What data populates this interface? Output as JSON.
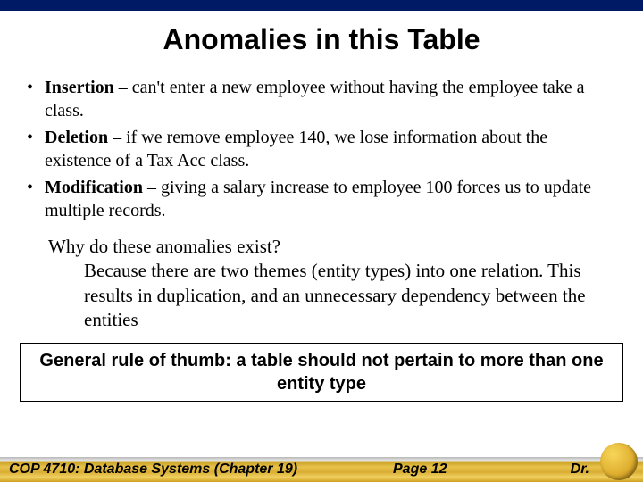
{
  "title": "Anomalies in this Table",
  "bullets": [
    {
      "term": "Insertion",
      "text": " – can't enter a new employee without having the employee take a class."
    },
    {
      "term": "Deletion",
      "text": " – if we remove employee 140, we lose information about the existence of a Tax Acc class."
    },
    {
      "term": "Modification",
      "text": " – giving a salary increase to employee 100 forces us to update multiple records."
    }
  ],
  "why": {
    "q": "Why do these anomalies exist?",
    "a": "Because there are two themes (entity types) into one relation. This results in duplication, and an unnecessary dependency between the entities"
  },
  "rule": "General rule of thumb: a table should not pertain to more than one entity type",
  "footer": {
    "course": "COP 4710: Database Systems  (Chapter 19)",
    "page": "Page 12",
    "dr": "Dr."
  }
}
